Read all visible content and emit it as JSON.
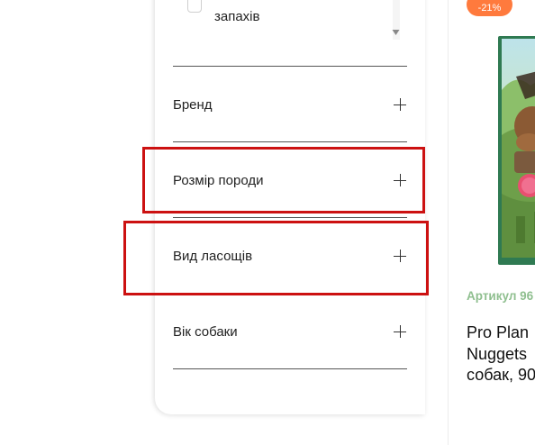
{
  "filters": {
    "partial_option_top": "...",
    "option_label": "запахів",
    "sections": [
      {
        "label": "Бренд"
      },
      {
        "label": "Розмір породи"
      },
      {
        "label": "Вид ласощів"
      },
      {
        "label": "Вік собаки"
      }
    ]
  },
  "product": {
    "discount": "-21%",
    "sku": "Артикул 96",
    "title_lines": [
      "Pro Plan",
      "Nuggets",
      "собак, 90"
    ],
    "badge_color": "#ff7a3d",
    "sku_color": "#8fbf8f"
  },
  "icons": {
    "expand": "plus-icon",
    "scroll": "chevron-down-icon"
  },
  "highlight_color": "#cc1111"
}
